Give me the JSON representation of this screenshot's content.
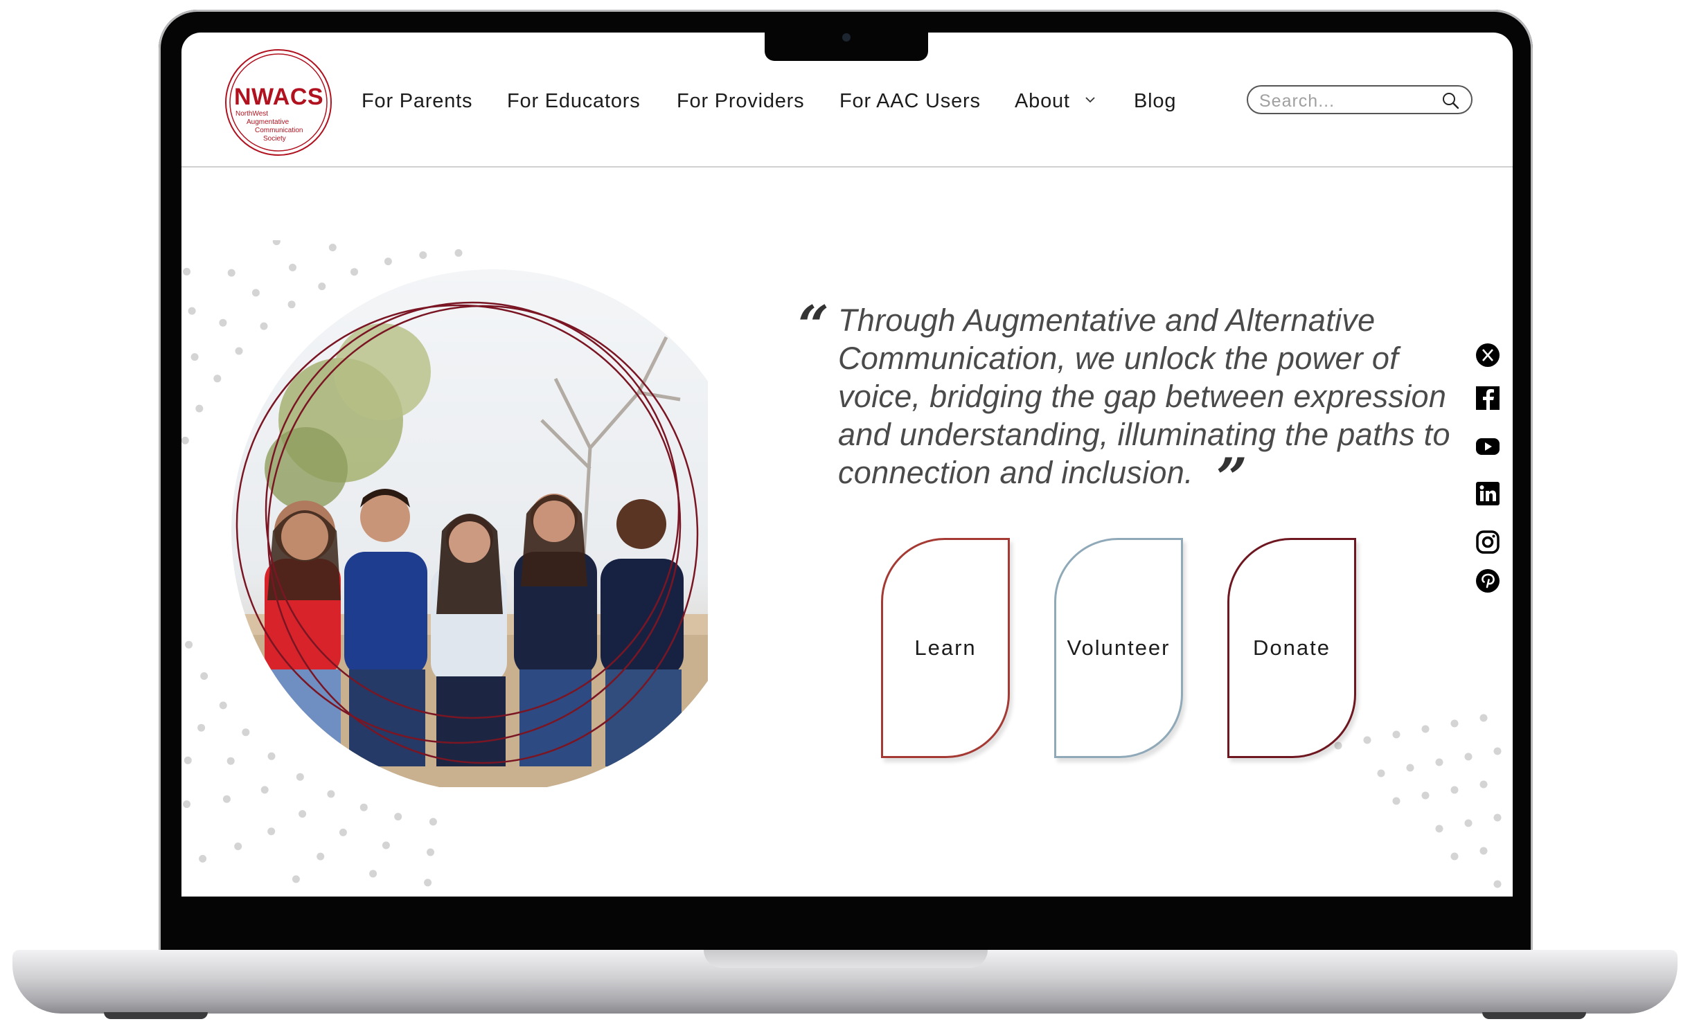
{
  "logo": {
    "title": "NWACS",
    "subtitle_lines": [
      "NorthWest",
      "Augmentative",
      "Communication",
      "Society"
    ]
  },
  "nav": {
    "items": [
      "For Parents",
      "For Educators",
      "For Providers",
      "For AAC Users",
      "About",
      "Blog"
    ]
  },
  "search": {
    "placeholder": "Search...",
    "icon": "search-icon"
  },
  "hero": {
    "photo_description_icon": "group-photo",
    "quote": "Through Augmentative and Alternative Communication, we unlock the power of voice, bridging the gap between expression and understanding, illuminating the paths to connection and inclusion.",
    "quote_open": "“",
    "quote_close": "”"
  },
  "actions": [
    {
      "label": "Learn",
      "color": "#a53a34"
    },
    {
      "label": "Volunteer",
      "color": "#8fa9b8"
    },
    {
      "label": "Donate",
      "color": "#6e1720"
    }
  ],
  "social_icons": [
    "x-icon",
    "facebook-icon",
    "youtube-icon",
    "linkedin-icon",
    "instagram-icon",
    "pinterest-icon"
  ],
  "colors": {
    "brand": "#b0121f",
    "ring": "#7a1624",
    "text": "#1c1c1c"
  }
}
